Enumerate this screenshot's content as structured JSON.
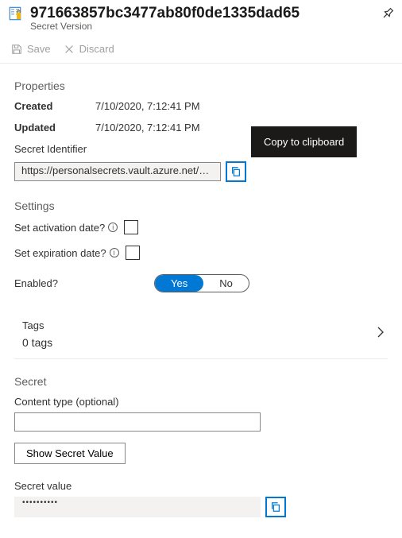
{
  "header": {
    "title": "971663857bc3477ab80f0de1335dad65",
    "subtitle": "Secret Version"
  },
  "toolbar": {
    "save_label": "Save",
    "discard_label": "Discard"
  },
  "properties": {
    "heading": "Properties",
    "created_label": "Created",
    "created_value": "7/10/2020, 7:12:41 PM",
    "updated_label": "Updated",
    "updated_value": "7/10/2020, 7:12:41 PM",
    "secret_identifier_label": "Secret Identifier",
    "secret_identifier_value": "https://personalsecrets.vault.azure.net/…",
    "copy_tooltip": "Copy to clipboard"
  },
  "settings": {
    "heading": "Settings",
    "activation_label": "Set activation date?",
    "expiration_label": "Set expiration date?",
    "enabled_label": "Enabled?",
    "enabled_yes": "Yes",
    "enabled_no": "No",
    "tags_label": "Tags",
    "tags_count": "0 tags"
  },
  "secret": {
    "heading": "Secret",
    "content_type_label": "Content type (optional)",
    "content_type_value": "",
    "show_value_label": "Show Secret Value",
    "secret_value_label": "Secret value",
    "secret_value_masked": "••••••••••"
  }
}
